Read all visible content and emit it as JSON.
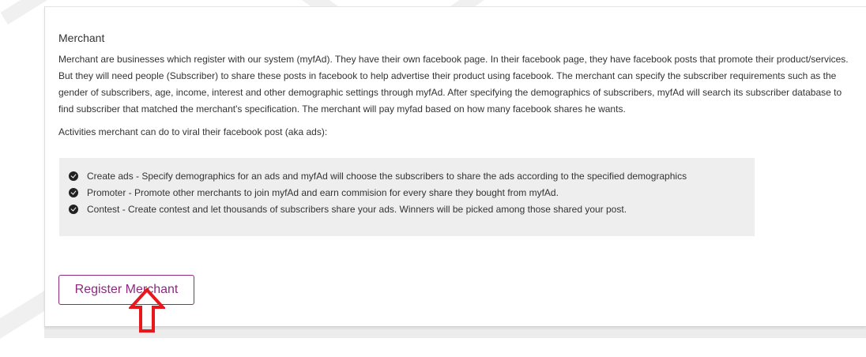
{
  "merchant_section": {
    "title": "Merchant",
    "description": "Merchant are businesses which register with our system (myfAd). They have their own facebook page. In their facebook page, they have facebook posts that promote their product/services. But they will need people (Subscriber) to share these posts in facebook to help advertise their product using facebook. The merchant can specify the subscriber requirements such as the gender of subscribers, age, income, interest and other demographic settings through myfAd. After specifying the demographics of subscribers, myfAd will search its subscriber database to find subscriber that matched the merchant's specification. The merchant will pay myfad based on how many facebook shares he wants.",
    "activities_intro": "Activities merchant can do to viral their facebook post (aka ads):",
    "features": [
      {
        "icon": "check-circle-icon",
        "text": "Create ads - Specify demographics for an ads and myfAd will choose the subscribers to share the ads according to the specified demographics"
      },
      {
        "icon": "check-circle-icon",
        "text": "Promoter - Promote other merchants to join myfAd and earn commision for every share they bought from myfAd."
      },
      {
        "icon": "check-circle-icon",
        "text": "Contest - Create contest and let thousands of subscribers share your ads. Winners will be picked among those shared your post."
      }
    ],
    "register_button_label": "Register Merchant"
  },
  "colors": {
    "accent": "#8b2a7e",
    "arrow": "#e8171b",
    "feature_box_bg": "#eeeeee",
    "text": "#333333"
  }
}
